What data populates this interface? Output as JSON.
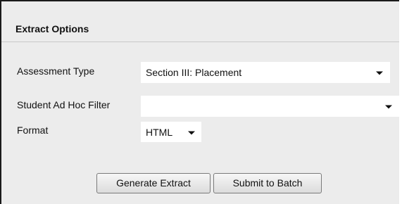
{
  "panel": {
    "title": "Extract Options"
  },
  "fields": {
    "assessment_type": {
      "label": "Assessment Type",
      "value": "Section III: Placement"
    },
    "ad_hoc_filter": {
      "label": "Student Ad Hoc Filter",
      "value": ""
    },
    "format": {
      "label": "Format",
      "value": "HTML"
    }
  },
  "buttons": {
    "generate": "Generate Extract",
    "submit_batch": "Submit to Batch"
  },
  "icons": {
    "dropdown": "chevron-down-icon"
  }
}
